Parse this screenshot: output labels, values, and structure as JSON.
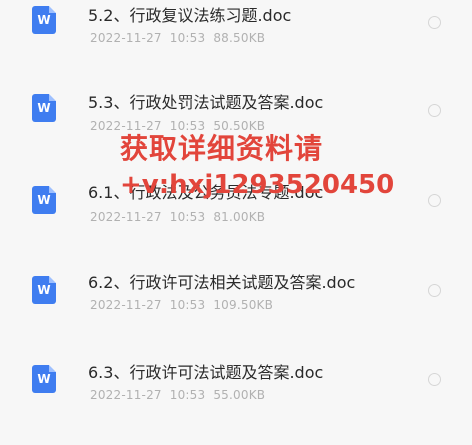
{
  "files": [
    {
      "name": "5.2、行政复议法练习题.doc",
      "date": "2022-11-27",
      "time": "10:53",
      "size": "88.50KB",
      "icon": "word-doc-icon"
    },
    {
      "name": "5.3、行政处罚法试题及答案.doc",
      "date": "2022-11-27",
      "time": "10:53",
      "size": "50.50KB",
      "icon": "word-doc-icon"
    },
    {
      "name": "6.1、行政法及公务员法专题.doc",
      "date": "2022-11-27",
      "time": "10:53",
      "size": "81.00KB",
      "icon": "word-doc-icon"
    },
    {
      "name": "6.2、行政许可法相关试题及答案.doc",
      "date": "2022-11-27",
      "time": "10:53",
      "size": "109.50KB",
      "icon": "word-doc-icon"
    },
    {
      "name": "6.3、行政许可法试题及答案.doc",
      "date": "2022-11-27",
      "time": "10:53",
      "size": "55.00KB",
      "icon": "word-doc-icon"
    }
  ],
  "icon_letter": "W",
  "watermark": {
    "line1": "获取详细资料请",
    "line2": "+v:hxj1293520450"
  },
  "colors": {
    "doc_icon": "#3f7df0",
    "watermark": "#e2453b",
    "background": "#f7f7f7"
  }
}
